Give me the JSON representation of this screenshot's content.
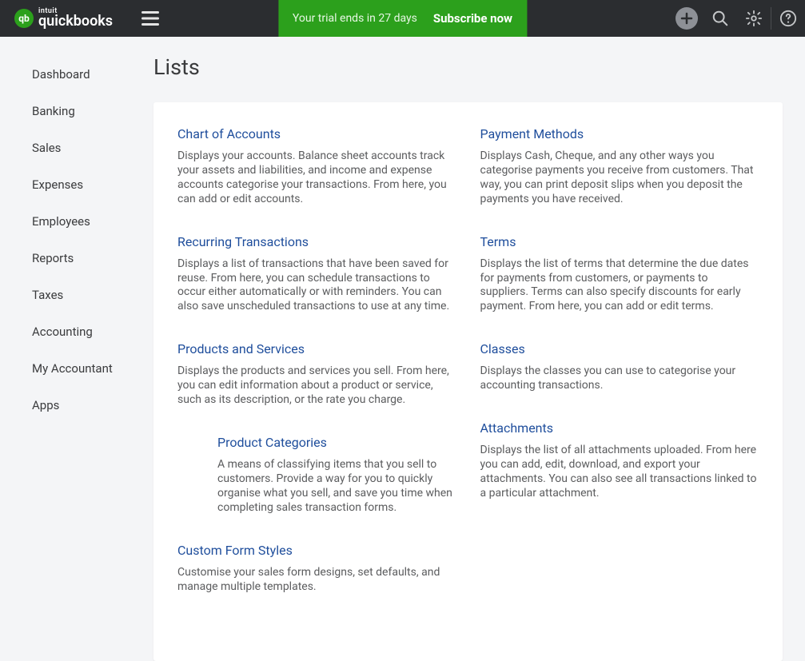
{
  "header": {
    "brand_small": "intuit",
    "brand_main": "quickbooks",
    "trial_text": "Your trial ends in 27 days",
    "subscribe_label": "Subscribe now"
  },
  "sidebar": {
    "items": [
      "Dashboard",
      "Banking",
      "Sales",
      "Expenses",
      "Employees",
      "Reports",
      "Taxes",
      "Accounting",
      "My Accountant",
      "Apps"
    ]
  },
  "page": {
    "title": "Lists"
  },
  "lists": {
    "left": [
      {
        "title": "Chart of Accounts",
        "desc": "Displays your accounts. Balance sheet accounts track your assets and liabilities, and income and expense accounts categorise your transactions. From here, you can add or edit accounts.",
        "indent": false
      },
      {
        "title": "Recurring Transactions",
        "desc": "Displays a list of transactions that have been saved for reuse. From here, you can schedule transactions to occur either automatically or with reminders. You can also save unscheduled transactions to use at any time.",
        "indent": false
      },
      {
        "title": "Products and Services",
        "desc": "Displays the products and services you sell. From here, you can edit information about a product or service, such as its description, or the rate you charge.",
        "indent": false
      },
      {
        "title": "Product Categories",
        "desc": "A means of classifying items that you sell to customers. Provide a way for you to quickly organise what you sell, and save you time when completing sales transaction forms.",
        "indent": true
      },
      {
        "title": "Custom Form Styles",
        "desc": "Customise your sales form designs, set defaults, and manage multiple templates.",
        "indent": false
      }
    ],
    "right": [
      {
        "title": "Payment Methods",
        "desc": "Displays Cash, Cheque, and any other ways you categorise payments you receive from customers. That way, you can print deposit slips when you deposit the payments you have received.",
        "indent": false
      },
      {
        "title": "Terms",
        "desc": "Displays the list of terms that determine the due dates for payments from customers, or payments to suppliers. Terms can also specify discounts for early payment. From here, you can add or edit terms.",
        "indent": false
      },
      {
        "title": "Classes",
        "desc": "Displays the classes you can use to categorise your accounting transactions.",
        "indent": false
      },
      {
        "title": "Attachments",
        "desc": "Displays the list of all attachments uploaded. From here you can add, edit, download, and export your attachments. You can also see all transactions linked to a particular attachment.",
        "indent": false
      }
    ]
  }
}
